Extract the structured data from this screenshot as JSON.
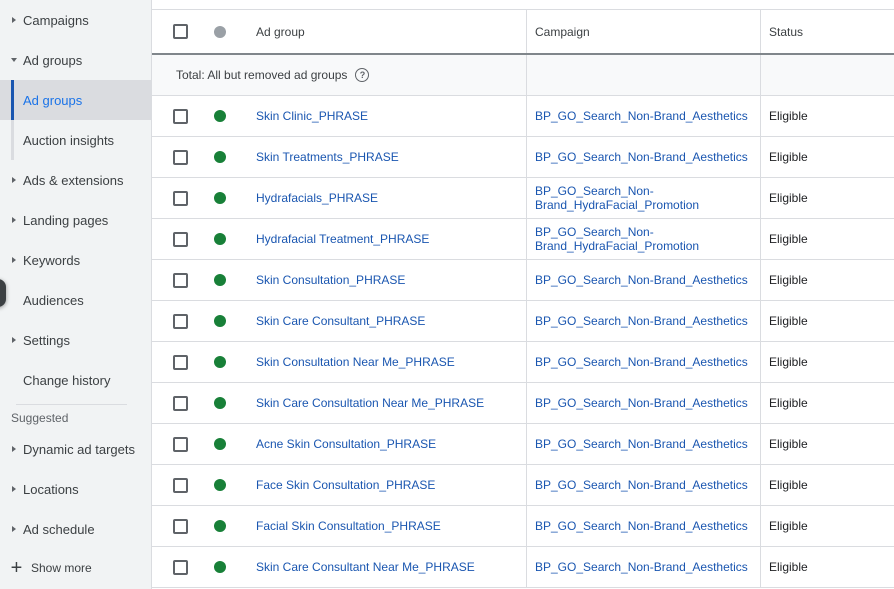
{
  "sidebar": {
    "items": [
      {
        "label": "Campaigns",
        "caret": "right"
      },
      {
        "label": "Ad groups",
        "caret": "down"
      },
      {
        "label": "Ad groups",
        "selected": true
      },
      {
        "label": "Auction insights"
      },
      {
        "label": "Ads & extensions",
        "caret": "right"
      },
      {
        "label": "Landing pages",
        "caret": "right"
      },
      {
        "label": "Keywords",
        "caret": "right"
      },
      {
        "label": "Audiences"
      },
      {
        "label": "Settings",
        "caret": "right"
      },
      {
        "label": "Change history"
      }
    ],
    "suggested_label": "Suggested",
    "suggested_items": [
      {
        "label": "Dynamic ad targets",
        "caret": "right"
      },
      {
        "label": "Locations",
        "caret": "right"
      },
      {
        "label": "Ad schedule",
        "caret": "right"
      }
    ],
    "show_more_label": "Show more"
  },
  "table": {
    "headers": {
      "ad_group": "Ad group",
      "campaign": "Campaign",
      "status": "Status"
    },
    "total_label": "Total: All but removed ad groups",
    "rows": [
      {
        "ad_group": "Skin Clinic_PHRASE",
        "campaign": "BP_GO_Search_Non-Brand_Aesthetics",
        "status": "Eligible"
      },
      {
        "ad_group": "Skin Treatments_PHRASE",
        "campaign": "BP_GO_Search_Non-Brand_Aesthetics",
        "status": "Eligible"
      },
      {
        "ad_group": "Hydrafacials_PHRASE",
        "campaign": "BP_GO_Search_Non-Brand_HydraFacial_Promotion",
        "status": "Eligible"
      },
      {
        "ad_group": "Hydrafacial Treatment_PHRASE",
        "campaign": "BP_GO_Search_Non-Brand_HydraFacial_Promotion",
        "status": "Eligible"
      },
      {
        "ad_group": "Skin Consultation_PHRASE",
        "campaign": "BP_GO_Search_Non-Brand_Aesthetics",
        "status": "Eligible"
      },
      {
        "ad_group": "Skin Care Consultant_PHRASE",
        "campaign": "BP_GO_Search_Non-Brand_Aesthetics",
        "status": "Eligible"
      },
      {
        "ad_group": "Skin Consultation Near Me_PHRASE",
        "campaign": "BP_GO_Search_Non-Brand_Aesthetics",
        "status": "Eligible"
      },
      {
        "ad_group": "Skin Care Consultation Near Me_PHRASE",
        "campaign": "BP_GO_Search_Non-Brand_Aesthetics",
        "status": "Eligible"
      },
      {
        "ad_group": "Acne Skin Consultation_PHRASE",
        "campaign": "BP_GO_Search_Non-Brand_Aesthetics",
        "status": "Eligible"
      },
      {
        "ad_group": "Face Skin Consultation_PHRASE",
        "campaign": "BP_GO_Search_Non-Brand_Aesthetics",
        "status": "Eligible"
      },
      {
        "ad_group": "Facial Skin Consultation_PHRASE",
        "campaign": "BP_GO_Search_Non-Brand_Aesthetics",
        "status": "Eligible"
      },
      {
        "ad_group": "Skin Care Consultant Near Me_PHRASE",
        "campaign": "BP_GO_Search_Non-Brand_Aesthetics",
        "status": "Eligible"
      }
    ]
  },
  "colors": {
    "link": "#1a56b0",
    "enabled_dot": "#188038",
    "header_dot": "#9aa0a6",
    "sidebar_bg": "#f1f3f4"
  }
}
